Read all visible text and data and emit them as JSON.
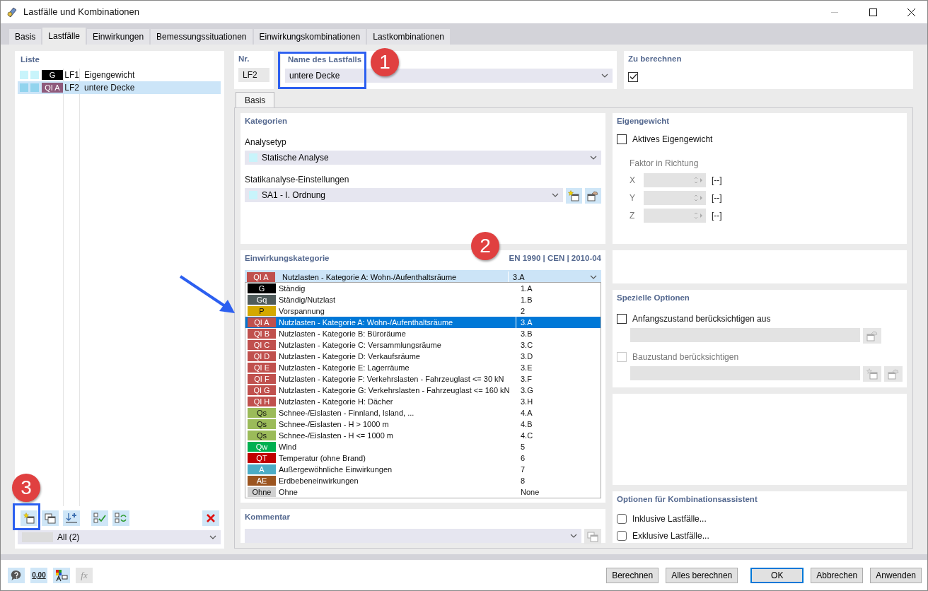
{
  "window": {
    "title": "Lastfälle und Kombinationen"
  },
  "tabs": [
    {
      "label": "Basis",
      "selected": false
    },
    {
      "label": "Lastfälle",
      "selected": true
    },
    {
      "label": "Einwirkungen",
      "selected": false
    },
    {
      "label": "Bemessungssituationen",
      "selected": false
    },
    {
      "label": "Einwirkungskombinationen",
      "selected": false
    },
    {
      "label": "Lastkombinationen",
      "selected": false
    }
  ],
  "list": {
    "header": "Liste",
    "items": [
      {
        "tag": "G",
        "color": "#000000",
        "number": "LF1",
        "name": "Eigengewicht",
        "selected": false
      },
      {
        "tag": "QI A",
        "color": "#8e5a7c",
        "number": "LF2",
        "name": "untere Decke",
        "selected": true
      }
    ],
    "tools": [
      {
        "kind": "new"
      },
      {
        "kind": "copy"
      },
      {
        "kind": "renumber"
      },
      {
        "kind": "check-all"
      },
      {
        "kind": "toggle"
      },
      {
        "kind": "delete"
      }
    ],
    "filter": "All (2)"
  },
  "nr": {
    "label": "Nr.",
    "value": "LF2"
  },
  "name": {
    "label": "Name des Lastfalls",
    "value": "untere Decke"
  },
  "to_calculate": {
    "label": "Zu berechnen",
    "checked": true
  },
  "inner_tabs": [
    {
      "label": "Basis",
      "selected": true
    }
  ],
  "categories": {
    "title": "Kategorien",
    "analysis_type": {
      "label": "Analysetyp",
      "value": "Statische Analyse"
    },
    "static_settings": {
      "label": "Statikanalyse-Einstellungen",
      "value": "SA1 - I. Ordnung"
    }
  },
  "action_category": {
    "title": "Einwirkungskategorie",
    "standard": "EN 1990 | CEN | 2010-04",
    "current": {
      "tag": "QI A",
      "color": "#c0504d",
      "name": "Nutzlasten - Kategorie A: Wohn-/Aufenthaltsräume",
      "code": "3.A"
    },
    "options": [
      {
        "tag": "G",
        "color": "#000000",
        "name": "Ständig",
        "code": "1.A",
        "selected": false
      },
      {
        "tag": "Gq",
        "color": "#4f5b5b",
        "name": "Ständig/Nutzlast",
        "code": "1.B",
        "selected": false
      },
      {
        "tag": "P",
        "color": "#d4a800",
        "name": "Vorspannung",
        "code": "2",
        "selected": false
      },
      {
        "tag": "QI A",
        "color": "#c0504d",
        "name": "Nutzlasten - Kategorie A: Wohn-/Aufenthaltsräume",
        "code": "3.A",
        "selected": true
      },
      {
        "tag": "QI B",
        "color": "#c0504d",
        "name": "Nutzlasten - Kategorie B: Büroräume",
        "code": "3.B",
        "selected": false
      },
      {
        "tag": "QI C",
        "color": "#c0504d",
        "name": "Nutzlasten - Kategorie C: Versammlungsräume",
        "code": "3.C",
        "selected": false
      },
      {
        "tag": "QI D",
        "color": "#c0504d",
        "name": "Nutzlasten - Kategorie D: Verkaufsräume",
        "code": "3.D",
        "selected": false
      },
      {
        "tag": "QI E",
        "color": "#c0504d",
        "name": "Nutzlasten - Kategorie E: Lagerräume",
        "code": "3.E",
        "selected": false
      },
      {
        "tag": "QI F",
        "color": "#c0504d",
        "name": "Nutzlasten - Kategorie F: Verkehrslasten - Fahrzeuglast <= 30 kN",
        "code": "3.F",
        "selected": false
      },
      {
        "tag": "QI G",
        "color": "#c0504d",
        "name": "Nutzlasten - Kategorie G: Verkehrslasten - Fahrzeuglast <= 160 kN",
        "code": "3.G",
        "selected": false
      },
      {
        "tag": "QI H",
        "color": "#c0504d",
        "name": "Nutzlasten - Kategorie H: Dächer",
        "code": "3.H",
        "selected": false
      },
      {
        "tag": "Qs",
        "color": "#9bbb59",
        "name": "Schnee-/Eislasten - Finnland, Island, ...",
        "code": "4.A",
        "selected": false
      },
      {
        "tag": "Qs",
        "color": "#9bbb59",
        "name": "Schnee-/Eislasten - H > 1000 m",
        "code": "4.B",
        "selected": false
      },
      {
        "tag": "Qs",
        "color": "#9bbb59",
        "name": "Schnee-/Eislasten - H <= 1000 m",
        "code": "4.C",
        "selected": false
      },
      {
        "tag": "Qw",
        "color": "#00b050",
        "name": "Wind",
        "code": "5",
        "selected": false
      },
      {
        "tag": "QT",
        "color": "#c00000",
        "name": "Temperatur (ohne Brand)",
        "code": "6",
        "selected": false
      },
      {
        "tag": "A",
        "color": "#4bacc6",
        "name": "Außergewöhnliche Einwirkungen",
        "code": "7",
        "selected": false
      },
      {
        "tag": "AE",
        "color": "#9c5520",
        "name": "Erdbebeneinwirkungen",
        "code": "8",
        "selected": false
      },
      {
        "tag": "Ohne",
        "color": "#d0d0d0",
        "name": "Ohne",
        "code": "None",
        "selected": false
      }
    ]
  },
  "self_weight": {
    "title": "Eigengewicht",
    "active": {
      "label": "Aktives Eigengewicht",
      "checked": false
    },
    "factor_label": "Faktor in Richtung",
    "disabled": true,
    "axes": [
      {
        "label": "X",
        "unit": "[--]"
      },
      {
        "label": "Y",
        "unit": "[--]"
      },
      {
        "label": "Z",
        "unit": "[--]"
      }
    ]
  },
  "special_options": {
    "title": "Spezielle Optionen",
    "items": [
      {
        "label": "Anfangszustand berücksichtigen aus",
        "checked": false,
        "disabled": false,
        "buttons": [
          {
            "kind": "edit"
          }
        ]
      },
      {
        "label": "Bauzustand berücksichtigen",
        "checked": false,
        "disabled": true,
        "buttons": [
          {
            "kind": "new"
          },
          {
            "kind": "edit"
          }
        ]
      }
    ]
  },
  "comment": {
    "title": "Kommentar"
  },
  "combination_options": {
    "title": "Optionen für Kombinationsassistent",
    "items": [
      {
        "label": "Inklusive Lastfälle...",
        "checked": false
      },
      {
        "label": "Exklusive Lastfälle...",
        "checked": false
      }
    ]
  },
  "footer_tools": [
    {
      "kind": "help"
    },
    {
      "kind": "decimals",
      "label": "0,00",
      "disabled": false
    },
    {
      "kind": "colors"
    },
    {
      "kind": "formula",
      "label": "fx",
      "disabled": true
    }
  ],
  "footer_buttons": [
    {
      "label": "Berechnen",
      "default": false
    },
    {
      "label": "Alles berechnen",
      "default": false
    },
    {
      "label": "OK",
      "default": true
    },
    {
      "label": "Abbrechen",
      "default": false
    },
    {
      "label": "Anwenden",
      "default": false
    }
  ],
  "callouts": [
    {
      "label": "1"
    },
    {
      "label": "2"
    },
    {
      "label": "3"
    }
  ]
}
